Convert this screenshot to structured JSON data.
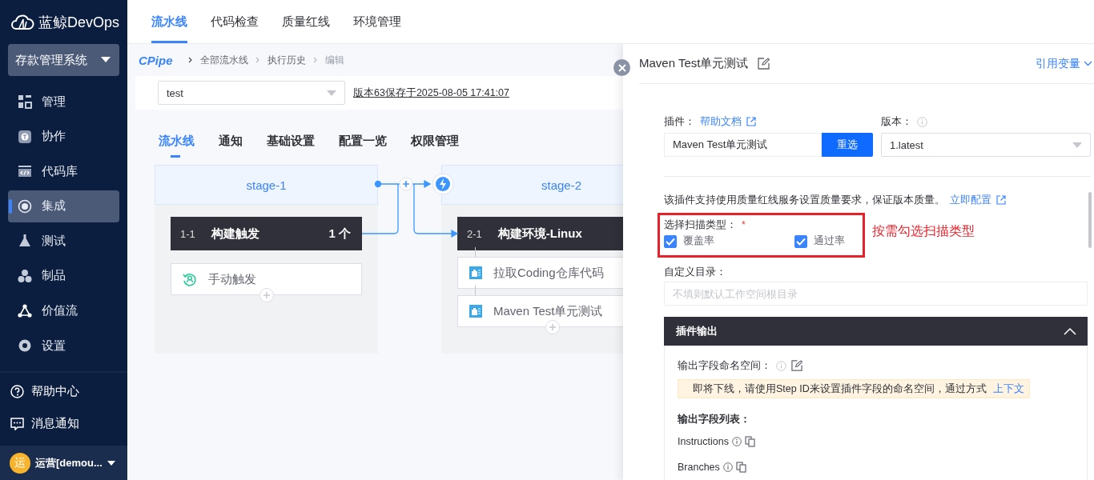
{
  "brand": {
    "name": "蓝鲸DevOps"
  },
  "top_nav": [
    {
      "label": "流水线",
      "selected": true
    },
    {
      "label": "代码检查",
      "selected": false
    },
    {
      "label": "质量红线",
      "selected": false
    },
    {
      "label": "环境管理",
      "selected": false
    }
  ],
  "sidebar": {
    "project": "存款管理系统",
    "items": [
      {
        "label": "管理",
        "selected": false
      },
      {
        "label": "协作",
        "selected": false
      },
      {
        "label": "代码库",
        "selected": false
      },
      {
        "label": "集成",
        "selected": true
      },
      {
        "label": "测试",
        "selected": false
      },
      {
        "label": "制品",
        "selected": false
      },
      {
        "label": "价值流",
        "selected": false
      },
      {
        "label": "设置",
        "selected": false
      }
    ],
    "footer_items": [
      {
        "label": "帮助中心"
      },
      {
        "label": "消息通知"
      }
    ],
    "user": {
      "avatar_text": "运",
      "name": "运营[demou..."
    }
  },
  "breadcrumb": {
    "logo": "CPipe",
    "items": [
      "全部流水线",
      "执行历史",
      "编辑"
    ]
  },
  "pipeline_select": {
    "value": "test"
  },
  "version_note": "版本63保存于2025-08-05 17:41:07",
  "tabs": [
    {
      "label": "流水线",
      "selected": true
    },
    {
      "label": "通知",
      "selected": false
    },
    {
      "label": "基础设置",
      "selected": false
    },
    {
      "label": "配置一览",
      "selected": false
    },
    {
      "label": "权限管理",
      "selected": false
    }
  ],
  "stages": [
    {
      "name": "stage-1",
      "jobs": [
        {
          "index": "1-1",
          "name": "构建触发",
          "count": "1 个",
          "steps": [
            {
              "name": "手动触发",
              "kind": "trigger"
            }
          ]
        }
      ]
    },
    {
      "name": "stage-2",
      "jobs": [
        {
          "index": "2-1",
          "name": "构建环境-Linux",
          "steps": [
            {
              "name": "拉取Coding仓库代码",
              "kind": "plugin"
            },
            {
              "name": "Maven Test单元测试",
              "kind": "plugin"
            }
          ]
        }
      ]
    }
  ],
  "drawer": {
    "title": "Maven Test单元测试",
    "variables_link": "引用变量",
    "plugin": {
      "label": "插件：",
      "help_link": "帮助文档",
      "value": "Maven Test单元测试",
      "reselect_button": "重选"
    },
    "version": {
      "label": "版本：",
      "value": "1.latest"
    },
    "quality_note": "该插件支持使用质量红线服务设置质量要求，保证版本质量。",
    "quality_link": "立即配置",
    "scan_types": {
      "label": "选择扫描类型：",
      "required_mark": "*",
      "options": [
        {
          "label": "覆盖率",
          "checked": true
        },
        {
          "label": "通过率",
          "checked": true
        }
      ]
    },
    "annotation": "按需勾选扫描类型",
    "custom_dir": {
      "label": "自定义目录：",
      "placeholder": "不填则默认工作空间根目录"
    },
    "output_section": {
      "title": "插件输出",
      "expanded": true,
      "namespace_label": "输出字段命名空间：",
      "warning": "即将下线，请使用Step ID来设置插件字段的命名空间，通过方式",
      "warning_link": "上下文",
      "fields_title": "输出字段列表：",
      "fields": [
        "Instructions",
        "Branches"
      ]
    }
  }
}
